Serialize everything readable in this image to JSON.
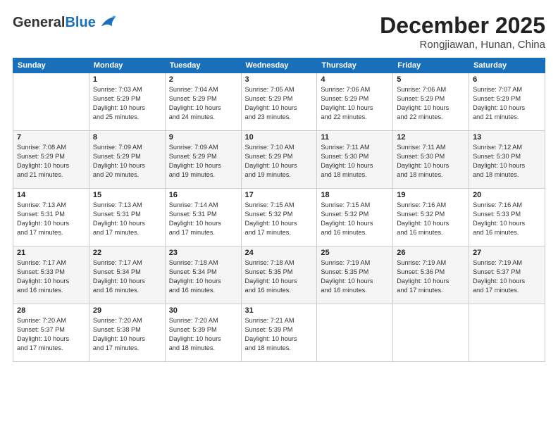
{
  "logo": {
    "general": "General",
    "blue": "Blue"
  },
  "title": "December 2025",
  "location": "Rongjiawan, Hunan, China",
  "days_of_week": [
    "Sunday",
    "Monday",
    "Tuesday",
    "Wednesday",
    "Thursday",
    "Friday",
    "Saturday"
  ],
  "weeks": [
    [
      {
        "day": "",
        "info": ""
      },
      {
        "day": "1",
        "info": "Sunrise: 7:03 AM\nSunset: 5:29 PM\nDaylight: 10 hours\nand 25 minutes."
      },
      {
        "day": "2",
        "info": "Sunrise: 7:04 AM\nSunset: 5:29 PM\nDaylight: 10 hours\nand 24 minutes."
      },
      {
        "day": "3",
        "info": "Sunrise: 7:05 AM\nSunset: 5:29 PM\nDaylight: 10 hours\nand 23 minutes."
      },
      {
        "day": "4",
        "info": "Sunrise: 7:06 AM\nSunset: 5:29 PM\nDaylight: 10 hours\nand 22 minutes."
      },
      {
        "day": "5",
        "info": "Sunrise: 7:06 AM\nSunset: 5:29 PM\nDaylight: 10 hours\nand 22 minutes."
      },
      {
        "day": "6",
        "info": "Sunrise: 7:07 AM\nSunset: 5:29 PM\nDaylight: 10 hours\nand 21 minutes."
      }
    ],
    [
      {
        "day": "7",
        "info": "Sunrise: 7:08 AM\nSunset: 5:29 PM\nDaylight: 10 hours\nand 21 minutes."
      },
      {
        "day": "8",
        "info": "Sunrise: 7:09 AM\nSunset: 5:29 PM\nDaylight: 10 hours\nand 20 minutes."
      },
      {
        "day": "9",
        "info": "Sunrise: 7:09 AM\nSunset: 5:29 PM\nDaylight: 10 hours\nand 19 minutes."
      },
      {
        "day": "10",
        "info": "Sunrise: 7:10 AM\nSunset: 5:29 PM\nDaylight: 10 hours\nand 19 minutes."
      },
      {
        "day": "11",
        "info": "Sunrise: 7:11 AM\nSunset: 5:30 PM\nDaylight: 10 hours\nand 18 minutes."
      },
      {
        "day": "12",
        "info": "Sunrise: 7:11 AM\nSunset: 5:30 PM\nDaylight: 10 hours\nand 18 minutes."
      },
      {
        "day": "13",
        "info": "Sunrise: 7:12 AM\nSunset: 5:30 PM\nDaylight: 10 hours\nand 18 minutes."
      }
    ],
    [
      {
        "day": "14",
        "info": "Sunrise: 7:13 AM\nSunset: 5:31 PM\nDaylight: 10 hours\nand 17 minutes."
      },
      {
        "day": "15",
        "info": "Sunrise: 7:13 AM\nSunset: 5:31 PM\nDaylight: 10 hours\nand 17 minutes."
      },
      {
        "day": "16",
        "info": "Sunrise: 7:14 AM\nSunset: 5:31 PM\nDaylight: 10 hours\nand 17 minutes."
      },
      {
        "day": "17",
        "info": "Sunrise: 7:15 AM\nSunset: 5:32 PM\nDaylight: 10 hours\nand 17 minutes."
      },
      {
        "day": "18",
        "info": "Sunrise: 7:15 AM\nSunset: 5:32 PM\nDaylight: 10 hours\nand 16 minutes."
      },
      {
        "day": "19",
        "info": "Sunrise: 7:16 AM\nSunset: 5:32 PM\nDaylight: 10 hours\nand 16 minutes."
      },
      {
        "day": "20",
        "info": "Sunrise: 7:16 AM\nSunset: 5:33 PM\nDaylight: 10 hours\nand 16 minutes."
      }
    ],
    [
      {
        "day": "21",
        "info": "Sunrise: 7:17 AM\nSunset: 5:33 PM\nDaylight: 10 hours\nand 16 minutes."
      },
      {
        "day": "22",
        "info": "Sunrise: 7:17 AM\nSunset: 5:34 PM\nDaylight: 10 hours\nand 16 minutes."
      },
      {
        "day": "23",
        "info": "Sunrise: 7:18 AM\nSunset: 5:34 PM\nDaylight: 10 hours\nand 16 minutes."
      },
      {
        "day": "24",
        "info": "Sunrise: 7:18 AM\nSunset: 5:35 PM\nDaylight: 10 hours\nand 16 minutes."
      },
      {
        "day": "25",
        "info": "Sunrise: 7:19 AM\nSunset: 5:35 PM\nDaylight: 10 hours\nand 16 minutes."
      },
      {
        "day": "26",
        "info": "Sunrise: 7:19 AM\nSunset: 5:36 PM\nDaylight: 10 hours\nand 17 minutes."
      },
      {
        "day": "27",
        "info": "Sunrise: 7:19 AM\nSunset: 5:37 PM\nDaylight: 10 hours\nand 17 minutes."
      }
    ],
    [
      {
        "day": "28",
        "info": "Sunrise: 7:20 AM\nSunset: 5:37 PM\nDaylight: 10 hours\nand 17 minutes."
      },
      {
        "day": "29",
        "info": "Sunrise: 7:20 AM\nSunset: 5:38 PM\nDaylight: 10 hours\nand 17 minutes."
      },
      {
        "day": "30",
        "info": "Sunrise: 7:20 AM\nSunset: 5:39 PM\nDaylight: 10 hours\nand 18 minutes."
      },
      {
        "day": "31",
        "info": "Sunrise: 7:21 AM\nSunset: 5:39 PM\nDaylight: 10 hours\nand 18 minutes."
      },
      {
        "day": "",
        "info": ""
      },
      {
        "day": "",
        "info": ""
      },
      {
        "day": "",
        "info": ""
      }
    ]
  ]
}
